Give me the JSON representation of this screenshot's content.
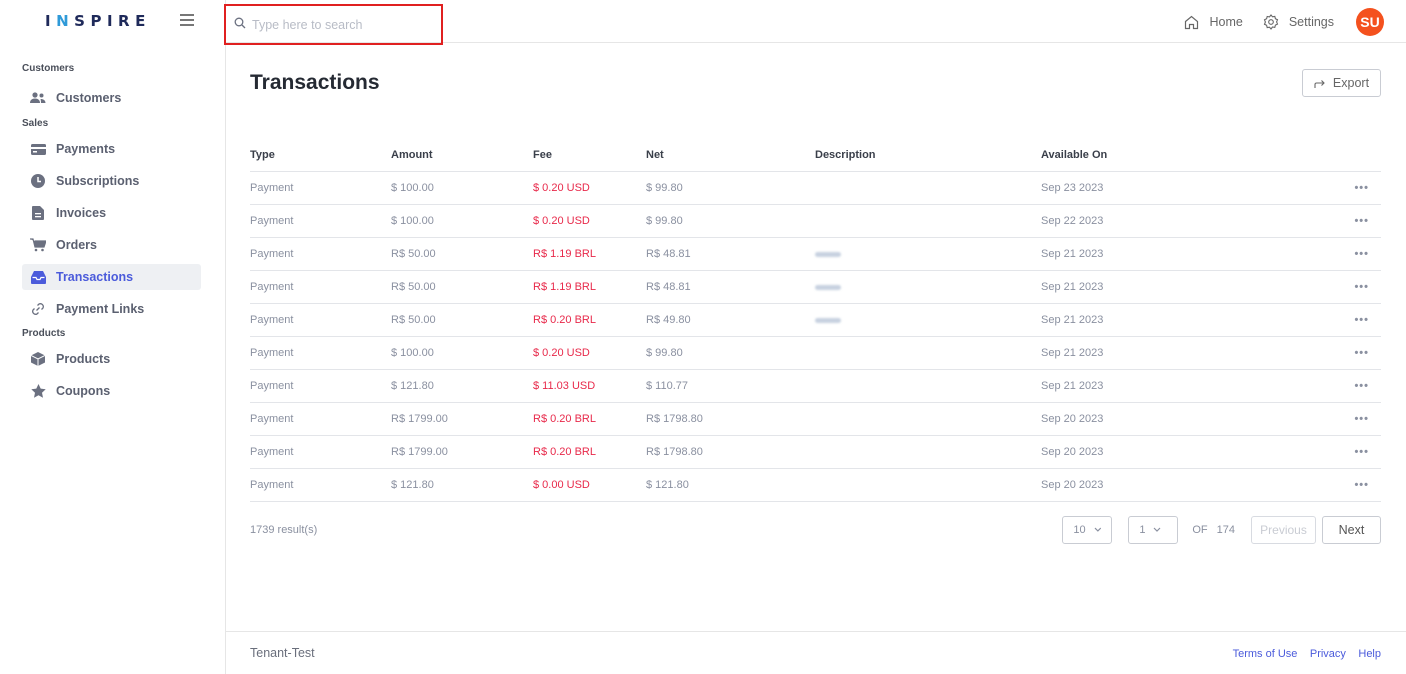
{
  "brand": {
    "logo_text_1": "I",
    "logo_text_accent": "N",
    "logo_text_2": "SPIRE"
  },
  "search": {
    "placeholder": "Type here to search"
  },
  "topbar": {
    "home_label": "Home",
    "settings_label": "Settings",
    "avatar_initials": "SU",
    "avatar_color": "#f4511e"
  },
  "sidebar": {
    "sections": {
      "customers": "Customers",
      "sales": "Sales",
      "products": "Products"
    },
    "items": {
      "customers": "Customers",
      "payments": "Payments",
      "subscriptions": "Subscriptions",
      "invoices": "Invoices",
      "orders": "Orders",
      "transactions": "Transactions",
      "payment_links": "Payment Links",
      "products": "Products",
      "coupons": "Coupons"
    },
    "active_item": "transactions"
  },
  "page": {
    "title": "Transactions",
    "export_label": "Export"
  },
  "table": {
    "columns": [
      "Type",
      "Amount",
      "Fee",
      "Net",
      "Description",
      "Available On"
    ],
    "rows": [
      {
        "type": "Payment",
        "amount": "$ 100.00",
        "fee": "$ 0.20 USD",
        "net": "$ 99.80",
        "available_on": "Sep 23 2023",
        "more": "•••"
      },
      {
        "type": "Payment",
        "amount": "$ 100.00",
        "fee": "$ 0.20 USD",
        "net": "$ 99.80",
        "available_on": "Sep 22 2023",
        "more": "•••"
      },
      {
        "type": "Payment",
        "amount": "R$ 50.00",
        "fee": "R$ 1.19 BRL",
        "net": "R$ 48.81",
        "available_on": "Sep 21 2023",
        "more": "•••"
      },
      {
        "type": "Payment",
        "amount": "R$ 50.00",
        "fee": "R$ 1.19 BRL",
        "net": "R$ 48.81",
        "available_on": "Sep 21 2023",
        "more": "•••"
      },
      {
        "type": "Payment",
        "amount": "R$ 50.00",
        "fee": "R$ 0.20 BRL",
        "net": "R$ 49.80",
        "available_on": "Sep 21 2023",
        "more": "•••"
      },
      {
        "type": "Payment",
        "amount": "$ 100.00",
        "fee": "$ 0.20 USD",
        "net": "$ 99.80",
        "available_on": "Sep 21 2023",
        "more": "•••"
      },
      {
        "type": "Payment",
        "amount": "$ 121.80",
        "fee": "$ 11.03 USD",
        "net": "$ 110.77",
        "available_on": "Sep 21 2023",
        "more": "•••"
      },
      {
        "type": "Payment",
        "amount": "R$ 1799.00",
        "fee": "R$ 0.20 BRL",
        "net": "R$ 1798.80",
        "available_on": "Sep 20 2023",
        "more": "•••"
      },
      {
        "type": "Payment",
        "amount": "R$ 1799.00",
        "fee": "R$ 0.20 BRL",
        "net": "R$ 1798.80",
        "available_on": "Sep 20 2023",
        "more": "•••"
      },
      {
        "type": "Payment",
        "amount": "$ 121.80",
        "fee": "$ 0.00 USD",
        "net": "$ 121.80",
        "available_on": "Sep 20 2023",
        "more": "•••"
      }
    ],
    "fee_color": "#e8294a"
  },
  "pagination": {
    "results": "1739 result(s)",
    "per_page": "10",
    "current_page": "1",
    "of_label": "OF",
    "total_pages": "174",
    "previous_label": "Previous",
    "next_label": "Next"
  },
  "footer": {
    "tenant": "Tenant-Test",
    "links": {
      "terms": "Terms of Use",
      "privacy": "Privacy",
      "help": "Help"
    },
    "link_color": "#4b5bdb"
  },
  "accent_color": "#4b5bdb"
}
